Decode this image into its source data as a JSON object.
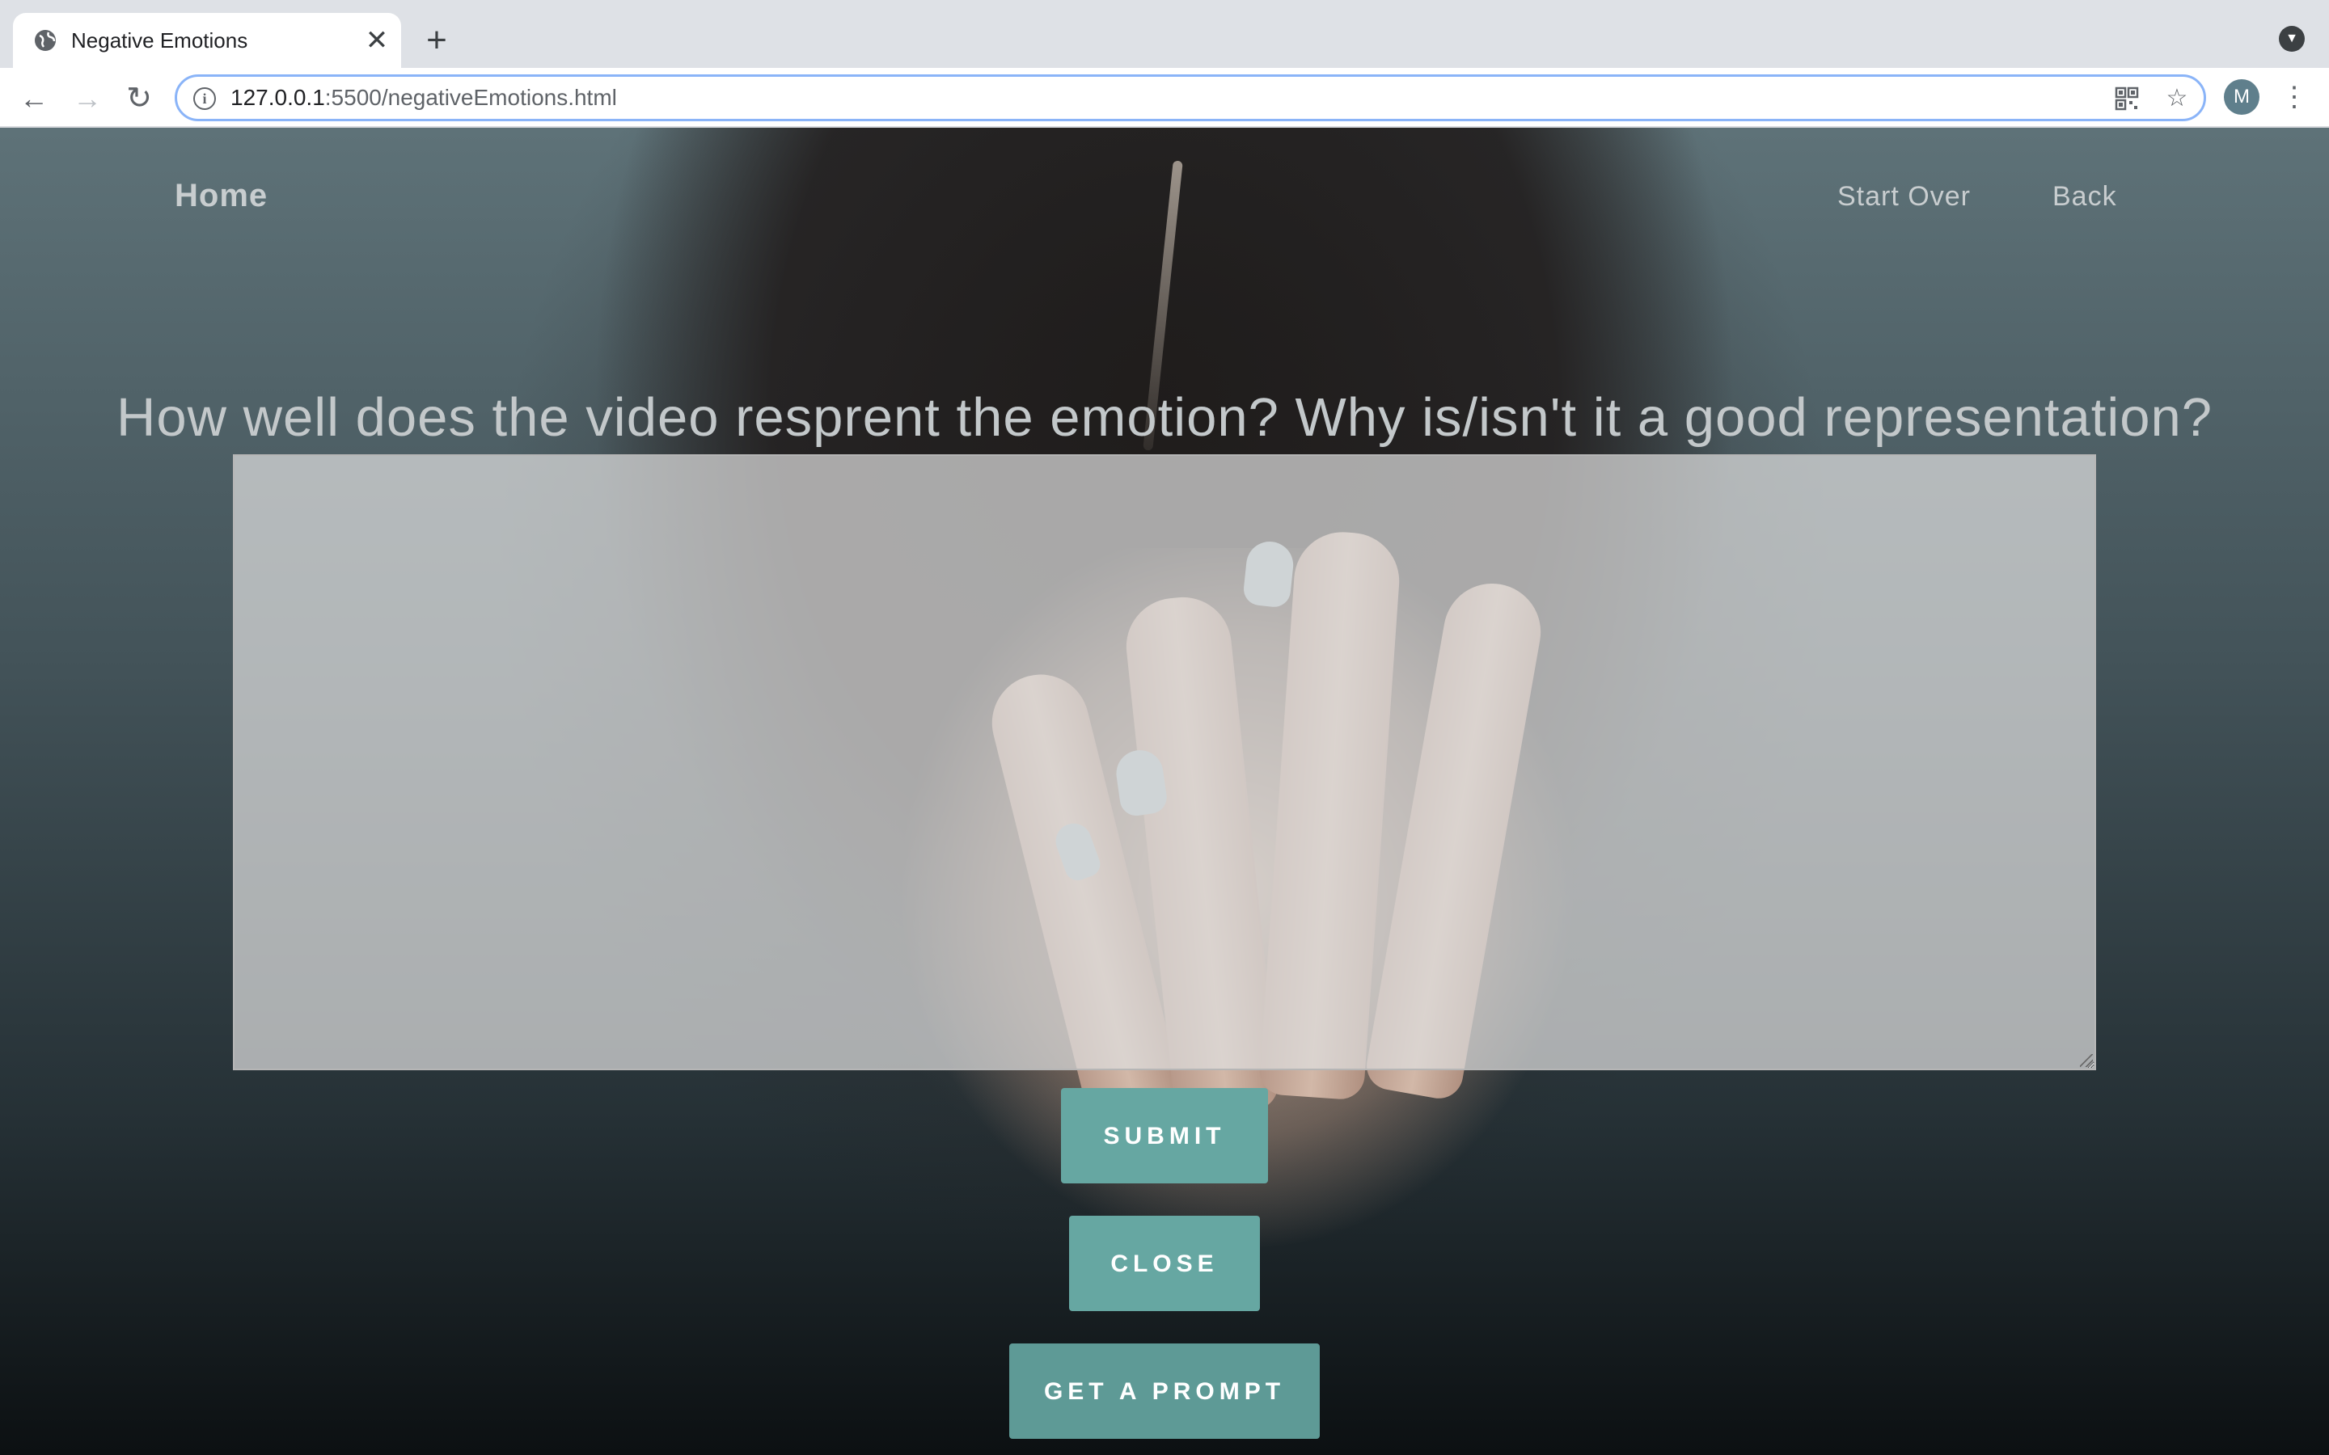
{
  "browser": {
    "tab_title": "Negative Emotions",
    "url_host": "127.0.0.1",
    "url_path": ":5500/negativeEmotions.html",
    "profile_initial": "M"
  },
  "icons": {
    "favicon": "globe-icon",
    "tab_close": "close-icon",
    "new_tab": "plus-icon",
    "back": "arrow-left-icon",
    "forward": "arrow-right-icon",
    "reload": "reload-icon",
    "site_info": "info-icon",
    "qr": "qr-code-icon",
    "bookmark": "star-icon",
    "menu": "kebab-menu-icon",
    "tab_search": "chevron-down-icon"
  },
  "site": {
    "nav": {
      "home": "Home",
      "start_over": "Start Over",
      "back": "Back"
    },
    "question": "How well does the video resprent the emotion? Why is/isn't it a good representation?",
    "answer": {
      "value": "",
      "placeholder": ""
    },
    "buttons": {
      "submit": "SUBMIT",
      "close": "CLOSE",
      "get_prompt": "GET A PROMPT"
    }
  },
  "colors": {
    "button": "#66a7a2",
    "nav_text": "#c8cdcf",
    "omnibox_focus": "#8ab4f8"
  }
}
